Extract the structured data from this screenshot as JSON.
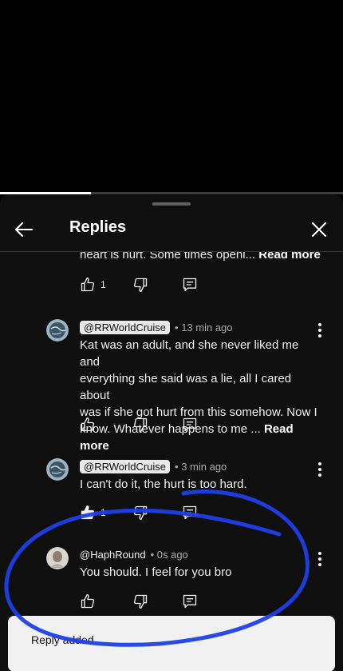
{
  "header": {
    "title": "Replies"
  },
  "video": {
    "progress_fraction": 0.265
  },
  "prev_comment": {
    "tail": "heart is hurt. Some times openi...",
    "read_more": "Read more",
    "likes": "1"
  },
  "comments": [
    {
      "handle": "@RRWorldCruise",
      "time": "• 13 min ago",
      "lines": [
        "Kat was an adult, and she never liked me and",
        "everything she said was a lie, all I cared about",
        "was if she got hurt from this somehow. Now I"
      ],
      "last_line": "know. Whatever happens to me ...",
      "read_more": "Read more",
      "likes": ""
    },
    {
      "handle": "@RRWorldCruise",
      "time": "• 3 min ago",
      "text": "I can't do it, the hurt is too hard.",
      "likes": "1"
    },
    {
      "handle": "@HaphRound",
      "time": "• 0s ago",
      "text": "You should.  I feel for you bro",
      "likes": ""
    }
  ],
  "toast": {
    "message": "Reply added"
  },
  "colors": {
    "annotation": "#1f3fe8",
    "sheet": "#0f0f0f",
    "accent": "#ffffff"
  },
  "icons": [
    "back-arrow-icon",
    "close-icon",
    "thumbs-up-icon",
    "thumbs-down-icon",
    "reply-icon",
    "more-vert-icon"
  ]
}
